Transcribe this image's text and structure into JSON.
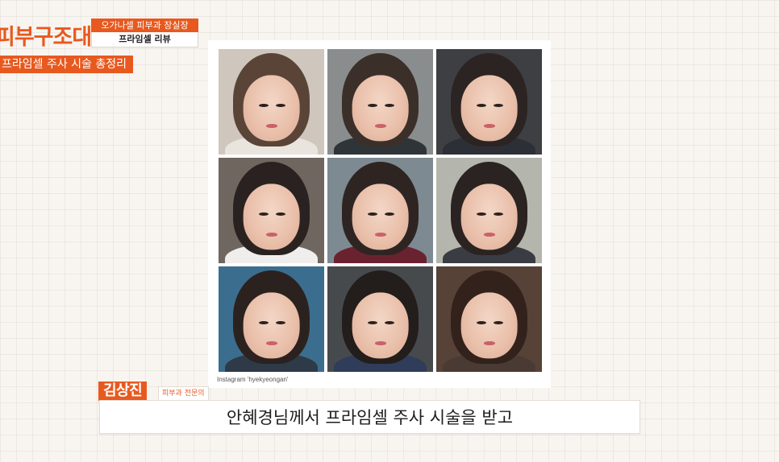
{
  "channel": {
    "title": "피부구조대"
  },
  "episode": {
    "top_label": "오가나셀 피부과 장실장",
    "bottom_label": "프라임셀 리뷰"
  },
  "subtitle": "프라임셀 주사 시술 총정리",
  "photo_card": {
    "credit": "Instagram 'hyekyeongan'",
    "photos": [
      {
        "bg": "#cfc7bd",
        "hair": "#5a4438",
        "shirt": "#e9e4de"
      },
      {
        "bg": "#8a8d8e",
        "hair": "#3b2f2a",
        "shirt": "#2f3438"
      },
      {
        "bg": "#3e3f42",
        "hair": "#2c2422",
        "shirt": "#2c3036"
      },
      {
        "bg": "#6f665f",
        "hair": "#2a2220",
        "shirt": "#efeeec"
      },
      {
        "bg": "#7e8a91",
        "hair": "#2e2523",
        "shirt": "#6b2230"
      },
      {
        "bg": "#b4b5ad",
        "hair": "#2a2321",
        "shirt": "#3a3c44"
      },
      {
        "bg": "#3b6e8e",
        "hair": "#2b2220",
        "shirt": "#2f3a48"
      },
      {
        "bg": "#474a4d",
        "hair": "#231d1b",
        "shirt": "#2f3d5a"
      },
      {
        "bg": "#574237",
        "hair": "#33221c",
        "shirt": "#4a3a34"
      }
    ]
  },
  "speaker": {
    "name": "김상진",
    "role": "피부과 전문의"
  },
  "caption": "안혜경님께서 프라임셀 주사 시술을 받고"
}
